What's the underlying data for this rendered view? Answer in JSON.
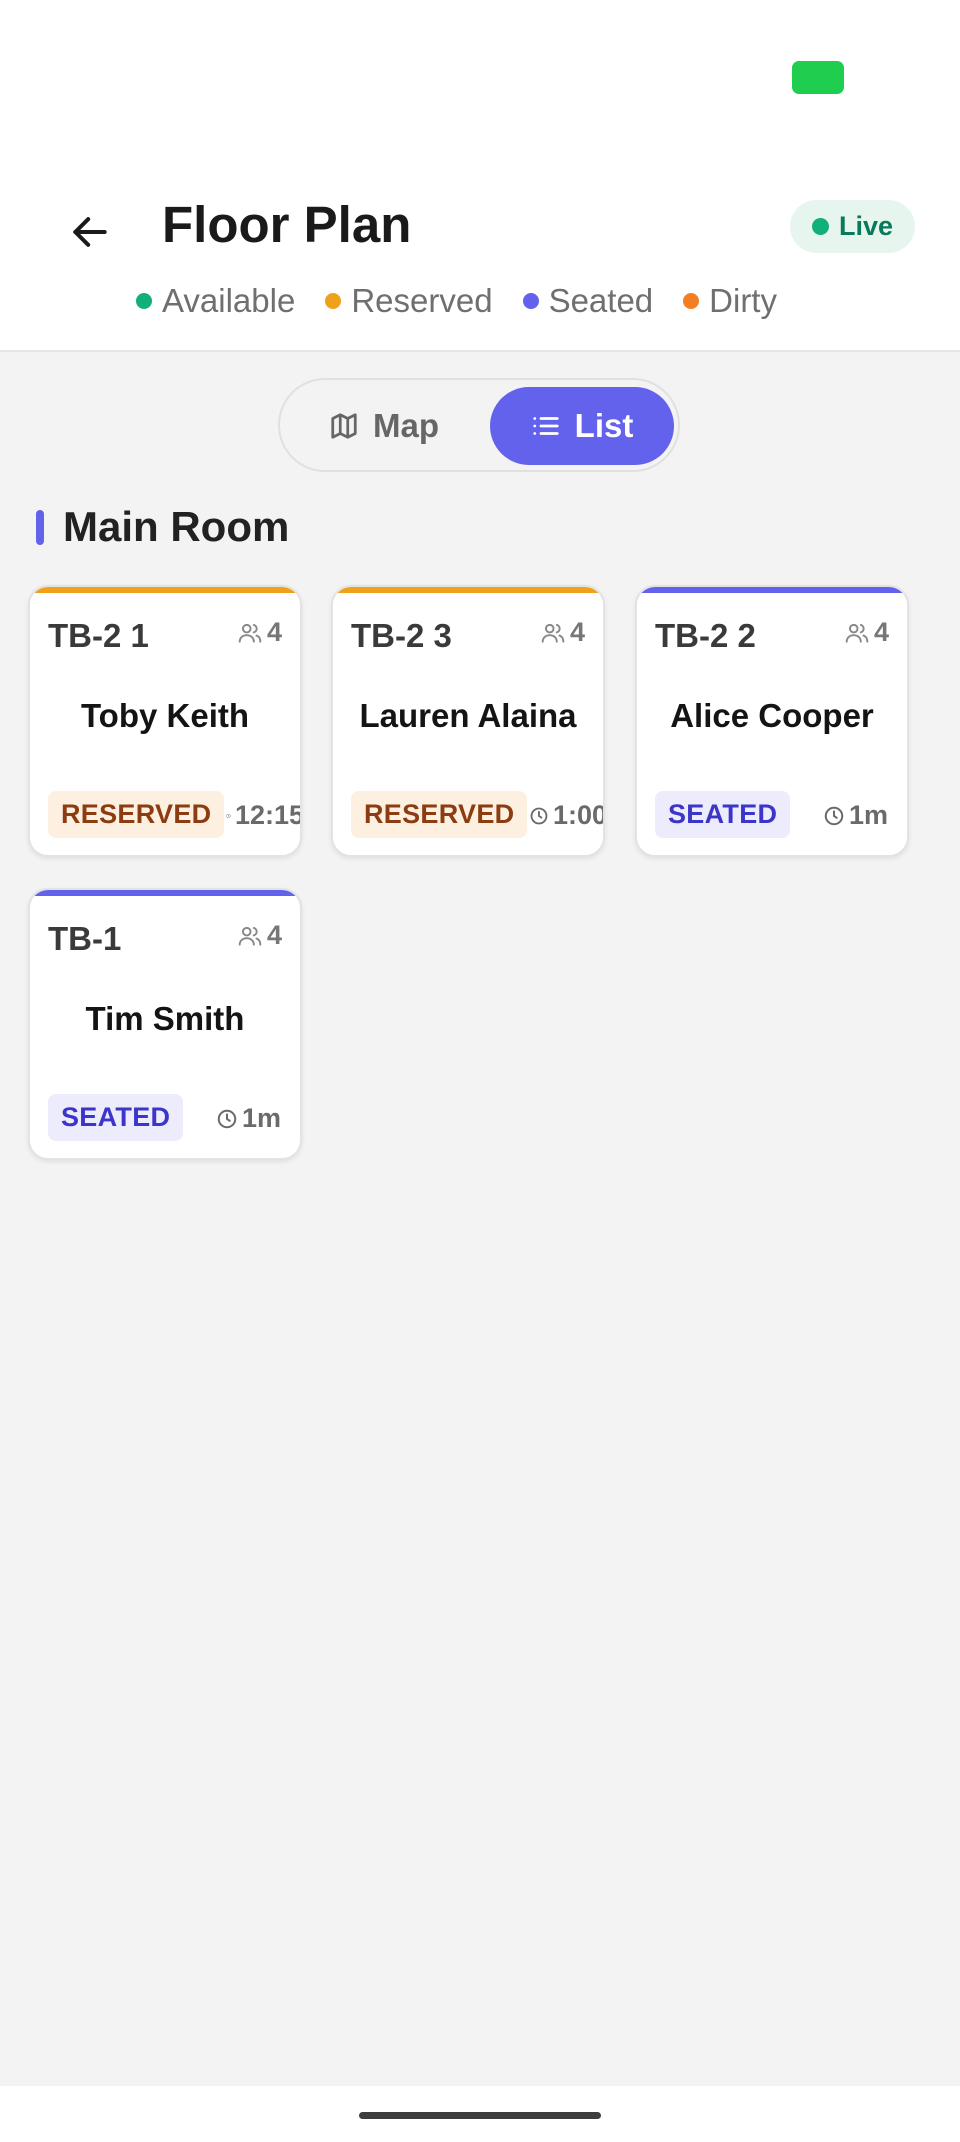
{
  "header": {
    "title": "Floor Plan",
    "live_label": "Live",
    "legend": [
      {
        "label": "Available",
        "color": "#11b07a"
      },
      {
        "label": "Reserved",
        "color": "#f0a11a"
      },
      {
        "label": "Seated",
        "color": "#6262ec"
      },
      {
        "label": "Dirty",
        "color": "#f47f22"
      }
    ]
  },
  "view_toggle": {
    "map_label": "Map",
    "list_label": "List",
    "selected": "List"
  },
  "section": {
    "title": "Main Room"
  },
  "tables": [
    {
      "id": "TB-2 1",
      "capacity": "4",
      "guest": "Toby Keith",
      "status": "RESERVED",
      "time": "12:15",
      "accent": "#f0a11a"
    },
    {
      "id": "TB-2 3",
      "capacity": "4",
      "guest": "Lauren Alaina",
      "status": "RESERVED",
      "time": "1:00",
      "accent": "#f0a11a"
    },
    {
      "id": "TB-2 2",
      "capacity": "4",
      "guest": "Alice Cooper",
      "status": "SEATED",
      "time": "1m",
      "accent": "#6262ec"
    },
    {
      "id": "TB-1",
      "capacity": "4",
      "guest": "Tim Smith",
      "status": "SEATED",
      "time": "1m",
      "accent": "#6262ec"
    }
  ]
}
